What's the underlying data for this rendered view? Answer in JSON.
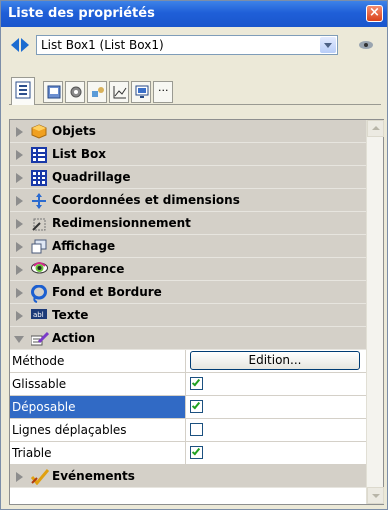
{
  "window": {
    "title": "Liste des propriétés",
    "close_glyph": "×"
  },
  "object_selector": {
    "value": "List Box1 (List Box1)"
  },
  "tabs": [
    {
      "icon": "list-properties-icon",
      "active": true
    },
    {
      "icon": "form-icon",
      "active": false
    },
    {
      "icon": "gear-icon",
      "active": false
    },
    {
      "icon": "shapes-icon",
      "active": false
    },
    {
      "icon": "chart-icon",
      "active": false
    },
    {
      "icon": "monitor-icon",
      "active": false
    },
    {
      "icon": "more-icon",
      "active": false,
      "label": "···"
    }
  ],
  "categories": {
    "objets": "Objets",
    "list_box": "List Box",
    "quadrillage": "Quadrillage",
    "coordonnees": "Coordonnées et dimensions",
    "redimensionnement": "Redimensionnement",
    "affichage": "Affichage",
    "apparence": "Apparence",
    "fond": "Fond et Bordure",
    "texte": "Texte",
    "action": "Action",
    "evenements": "Evénements"
  },
  "action_props": {
    "methode": {
      "label": "Méthode",
      "button": "Edition..."
    },
    "glissable": {
      "label": "Glissable",
      "checked": true
    },
    "deposable": {
      "label": "Déposable",
      "checked": true
    },
    "lignes": {
      "label": "Lignes déplaçables",
      "checked": false
    },
    "triable": {
      "label": "Triable",
      "checked": true
    }
  },
  "colors": {
    "title_bar": "#1f5fd8",
    "selection": "#316ac5",
    "checkmark": "#21a121",
    "category_bg": "#d4d0c8"
  }
}
